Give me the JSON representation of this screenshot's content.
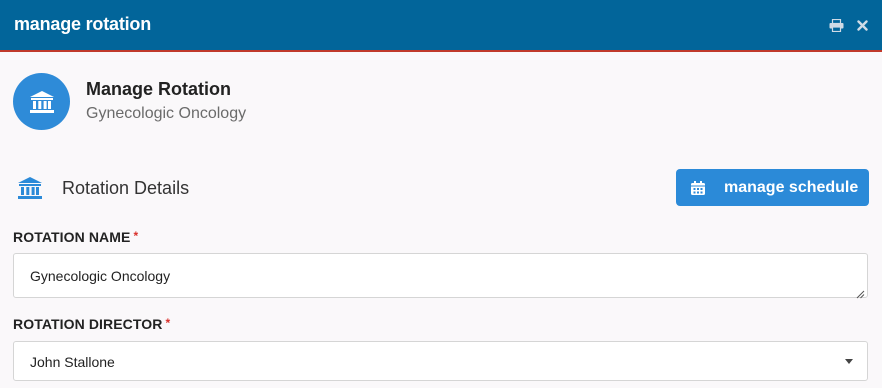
{
  "window": {
    "title": "manage rotation",
    "print_icon": "print-icon",
    "close_icon": "close-icon"
  },
  "header": {
    "icon": "institution-icon",
    "title": "Manage Rotation",
    "subtitle": "Gynecologic Oncology"
  },
  "section": {
    "icon": "institution-icon",
    "title": "Rotation Details",
    "schedule_button": {
      "icon": "calendar-icon",
      "label": "manage schedule"
    }
  },
  "form": {
    "rotation_name": {
      "label": "ROTATION NAME",
      "required_mark": "*",
      "value": "Gynecologic Oncology"
    },
    "rotation_director": {
      "label": "ROTATION DIRECTOR",
      "required_mark": "*",
      "value": "John Stallone"
    }
  },
  "colors": {
    "titlebar": "#02659a",
    "accent": "#2b8ad8",
    "required": "#d9302b"
  }
}
